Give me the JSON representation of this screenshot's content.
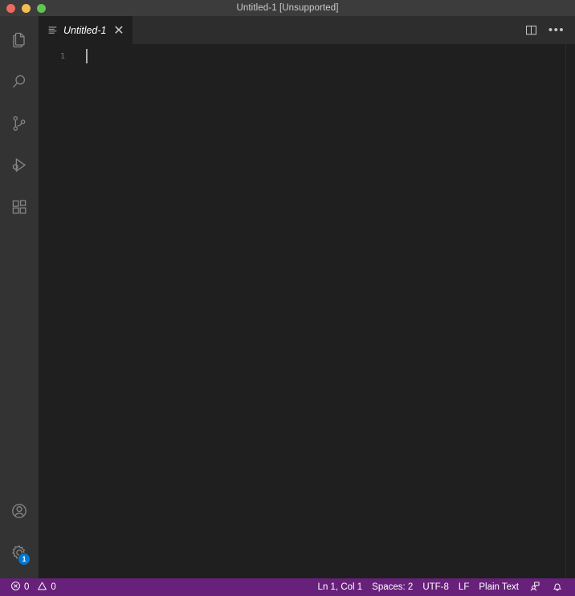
{
  "window": {
    "title": "Untitled-1 [Unsupported]",
    "traffic_lights": [
      {
        "name": "close",
        "color": "#ec6a5f"
      },
      {
        "name": "minimize",
        "color": "#f4bd50"
      },
      {
        "name": "maximize",
        "color": "#61c454"
      }
    ]
  },
  "activity_bar": {
    "top_items": [
      {
        "id": "explorer",
        "label": "Explorer",
        "icon": "files-icon"
      },
      {
        "id": "search",
        "label": "Search",
        "icon": "search-icon"
      },
      {
        "id": "source-control",
        "label": "Source Control",
        "icon": "source-control-icon"
      },
      {
        "id": "run-debug",
        "label": "Run and Debug",
        "icon": "run-debug-icon"
      },
      {
        "id": "extensions",
        "label": "Extensions",
        "icon": "extensions-icon"
      }
    ],
    "bottom_items": [
      {
        "id": "accounts",
        "label": "Accounts",
        "icon": "account-icon",
        "badge": ""
      },
      {
        "id": "manage",
        "label": "Manage",
        "icon": "gear-icon",
        "badge": "1"
      }
    ],
    "badge_color": "#0078d4"
  },
  "editor": {
    "tabs": [
      {
        "label": "Untitled-1",
        "icon": "plain-text-file-icon",
        "active": true,
        "preview": true,
        "close_glyph": "✕"
      }
    ],
    "actions": [
      {
        "id": "split-editor",
        "label": "Split Editor",
        "icon": "split-editor-icon"
      },
      {
        "id": "more-actions",
        "label": "More Actions...",
        "icon": "ellipsis-icon",
        "glyph": "•••"
      }
    ],
    "line_numbers": [
      "1"
    ],
    "content_lines": [
      ""
    ],
    "cursor": {
      "line": 1,
      "column": 1
    }
  },
  "status_bar": {
    "background": "#68217a",
    "left": [
      {
        "id": "problems",
        "icon": "error-icon",
        "value": "0"
      },
      {
        "id": "problems-warn",
        "icon": "warning-icon",
        "value": "0"
      }
    ],
    "right": [
      {
        "id": "cursor-position",
        "label": "Ln 1, Col 1"
      },
      {
        "id": "indentation",
        "label": "Spaces: 2"
      },
      {
        "id": "encoding",
        "label": "UTF-8"
      },
      {
        "id": "eol",
        "label": "LF"
      },
      {
        "id": "language-mode",
        "label": "Plain Text"
      },
      {
        "id": "feedback",
        "icon": "feedback-icon",
        "label": ""
      },
      {
        "id": "notifications",
        "icon": "bell-icon",
        "label": ""
      }
    ]
  }
}
